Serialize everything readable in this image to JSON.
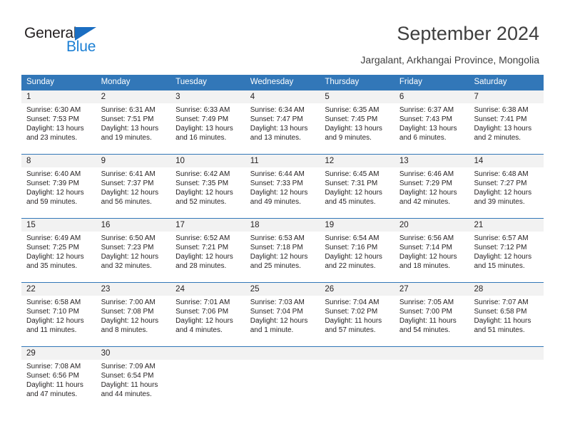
{
  "brand": {
    "name_dark": "General",
    "name_blue": "Blue",
    "accent_color": "#3277b8",
    "logo_blue": "#1b7fd4"
  },
  "header": {
    "title": "September 2024",
    "subtitle": "Jargalant, Arkhangai Province, Mongolia"
  },
  "weekdays": [
    "Sunday",
    "Monday",
    "Tuesday",
    "Wednesday",
    "Thursday",
    "Friday",
    "Saturday"
  ],
  "weeks": [
    [
      {
        "day": "1",
        "sunrise": "Sunrise: 6:30 AM",
        "sunset": "Sunset: 7:53 PM",
        "daylight1": "Daylight: 13 hours",
        "daylight2": "and 23 minutes."
      },
      {
        "day": "2",
        "sunrise": "Sunrise: 6:31 AM",
        "sunset": "Sunset: 7:51 PM",
        "daylight1": "Daylight: 13 hours",
        "daylight2": "and 19 minutes."
      },
      {
        "day": "3",
        "sunrise": "Sunrise: 6:33 AM",
        "sunset": "Sunset: 7:49 PM",
        "daylight1": "Daylight: 13 hours",
        "daylight2": "and 16 minutes."
      },
      {
        "day": "4",
        "sunrise": "Sunrise: 6:34 AM",
        "sunset": "Sunset: 7:47 PM",
        "daylight1": "Daylight: 13 hours",
        "daylight2": "and 13 minutes."
      },
      {
        "day": "5",
        "sunrise": "Sunrise: 6:35 AM",
        "sunset": "Sunset: 7:45 PM",
        "daylight1": "Daylight: 13 hours",
        "daylight2": "and 9 minutes."
      },
      {
        "day": "6",
        "sunrise": "Sunrise: 6:37 AM",
        "sunset": "Sunset: 7:43 PM",
        "daylight1": "Daylight: 13 hours",
        "daylight2": "and 6 minutes."
      },
      {
        "day": "7",
        "sunrise": "Sunrise: 6:38 AM",
        "sunset": "Sunset: 7:41 PM",
        "daylight1": "Daylight: 13 hours",
        "daylight2": "and 2 minutes."
      }
    ],
    [
      {
        "day": "8",
        "sunrise": "Sunrise: 6:40 AM",
        "sunset": "Sunset: 7:39 PM",
        "daylight1": "Daylight: 12 hours",
        "daylight2": "and 59 minutes."
      },
      {
        "day": "9",
        "sunrise": "Sunrise: 6:41 AM",
        "sunset": "Sunset: 7:37 PM",
        "daylight1": "Daylight: 12 hours",
        "daylight2": "and 56 minutes."
      },
      {
        "day": "10",
        "sunrise": "Sunrise: 6:42 AM",
        "sunset": "Sunset: 7:35 PM",
        "daylight1": "Daylight: 12 hours",
        "daylight2": "and 52 minutes."
      },
      {
        "day": "11",
        "sunrise": "Sunrise: 6:44 AM",
        "sunset": "Sunset: 7:33 PM",
        "daylight1": "Daylight: 12 hours",
        "daylight2": "and 49 minutes."
      },
      {
        "day": "12",
        "sunrise": "Sunrise: 6:45 AM",
        "sunset": "Sunset: 7:31 PM",
        "daylight1": "Daylight: 12 hours",
        "daylight2": "and 45 minutes."
      },
      {
        "day": "13",
        "sunrise": "Sunrise: 6:46 AM",
        "sunset": "Sunset: 7:29 PM",
        "daylight1": "Daylight: 12 hours",
        "daylight2": "and 42 minutes."
      },
      {
        "day": "14",
        "sunrise": "Sunrise: 6:48 AM",
        "sunset": "Sunset: 7:27 PM",
        "daylight1": "Daylight: 12 hours",
        "daylight2": "and 39 minutes."
      }
    ],
    [
      {
        "day": "15",
        "sunrise": "Sunrise: 6:49 AM",
        "sunset": "Sunset: 7:25 PM",
        "daylight1": "Daylight: 12 hours",
        "daylight2": "and 35 minutes."
      },
      {
        "day": "16",
        "sunrise": "Sunrise: 6:50 AM",
        "sunset": "Sunset: 7:23 PM",
        "daylight1": "Daylight: 12 hours",
        "daylight2": "and 32 minutes."
      },
      {
        "day": "17",
        "sunrise": "Sunrise: 6:52 AM",
        "sunset": "Sunset: 7:21 PM",
        "daylight1": "Daylight: 12 hours",
        "daylight2": "and 28 minutes."
      },
      {
        "day": "18",
        "sunrise": "Sunrise: 6:53 AM",
        "sunset": "Sunset: 7:18 PM",
        "daylight1": "Daylight: 12 hours",
        "daylight2": "and 25 minutes."
      },
      {
        "day": "19",
        "sunrise": "Sunrise: 6:54 AM",
        "sunset": "Sunset: 7:16 PM",
        "daylight1": "Daylight: 12 hours",
        "daylight2": "and 22 minutes."
      },
      {
        "day": "20",
        "sunrise": "Sunrise: 6:56 AM",
        "sunset": "Sunset: 7:14 PM",
        "daylight1": "Daylight: 12 hours",
        "daylight2": "and 18 minutes."
      },
      {
        "day": "21",
        "sunrise": "Sunrise: 6:57 AM",
        "sunset": "Sunset: 7:12 PM",
        "daylight1": "Daylight: 12 hours",
        "daylight2": "and 15 minutes."
      }
    ],
    [
      {
        "day": "22",
        "sunrise": "Sunrise: 6:58 AM",
        "sunset": "Sunset: 7:10 PM",
        "daylight1": "Daylight: 12 hours",
        "daylight2": "and 11 minutes."
      },
      {
        "day": "23",
        "sunrise": "Sunrise: 7:00 AM",
        "sunset": "Sunset: 7:08 PM",
        "daylight1": "Daylight: 12 hours",
        "daylight2": "and 8 minutes."
      },
      {
        "day": "24",
        "sunrise": "Sunrise: 7:01 AM",
        "sunset": "Sunset: 7:06 PM",
        "daylight1": "Daylight: 12 hours",
        "daylight2": "and 4 minutes."
      },
      {
        "day": "25",
        "sunrise": "Sunrise: 7:03 AM",
        "sunset": "Sunset: 7:04 PM",
        "daylight1": "Daylight: 12 hours",
        "daylight2": "and 1 minute."
      },
      {
        "day": "26",
        "sunrise": "Sunrise: 7:04 AM",
        "sunset": "Sunset: 7:02 PM",
        "daylight1": "Daylight: 11 hours",
        "daylight2": "and 57 minutes."
      },
      {
        "day": "27",
        "sunrise": "Sunrise: 7:05 AM",
        "sunset": "Sunset: 7:00 PM",
        "daylight1": "Daylight: 11 hours",
        "daylight2": "and 54 minutes."
      },
      {
        "day": "28",
        "sunrise": "Sunrise: 7:07 AM",
        "sunset": "Sunset: 6:58 PM",
        "daylight1": "Daylight: 11 hours",
        "daylight2": "and 51 minutes."
      }
    ],
    [
      {
        "day": "29",
        "sunrise": "Sunrise: 7:08 AM",
        "sunset": "Sunset: 6:56 PM",
        "daylight1": "Daylight: 11 hours",
        "daylight2": "and 47 minutes."
      },
      {
        "day": "30",
        "sunrise": "Sunrise: 7:09 AM",
        "sunset": "Sunset: 6:54 PM",
        "daylight1": "Daylight: 11 hours",
        "daylight2": "and 44 minutes."
      },
      {
        "day": "",
        "sunrise": "",
        "sunset": "",
        "daylight1": "",
        "daylight2": ""
      },
      {
        "day": "",
        "sunrise": "",
        "sunset": "",
        "daylight1": "",
        "daylight2": ""
      },
      {
        "day": "",
        "sunrise": "",
        "sunset": "",
        "daylight1": "",
        "daylight2": ""
      },
      {
        "day": "",
        "sunrise": "",
        "sunset": "",
        "daylight1": "",
        "daylight2": ""
      },
      {
        "day": "",
        "sunrise": "",
        "sunset": "",
        "daylight1": "",
        "daylight2": ""
      }
    ]
  ]
}
